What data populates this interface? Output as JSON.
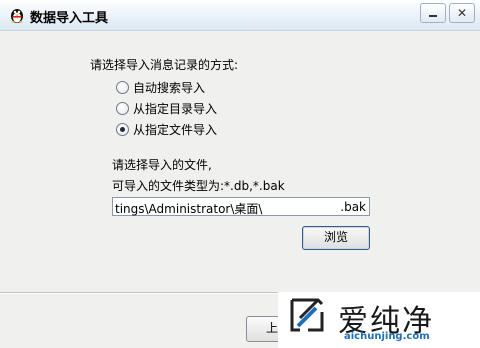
{
  "window": {
    "title": "数据导入工具",
    "minimize_icon": "minimize-icon",
    "close_icon": "close-icon",
    "app_icon": "penguin-icon"
  },
  "import_method": {
    "prompt": "请选择导入消息记录的方式:",
    "options": [
      {
        "label": "自动搜索导入",
        "checked": false
      },
      {
        "label": "从指定目录导入",
        "checked": false
      },
      {
        "label": "从指定文件导入",
        "checked": true
      }
    ]
  },
  "file_select": {
    "hint_line1": "请选择导入的文件,",
    "hint_line2": "可导入的文件类型为:*.db,*.bak",
    "path_value": "tings\\Administrator\\桌面\\",
    "path_suffix": ".bak",
    "browse_label": "浏览"
  },
  "footer": {
    "prev_label": "上一"
  },
  "watermark": {
    "brand": "爱纯净",
    "url": "aichunjing.com"
  }
}
